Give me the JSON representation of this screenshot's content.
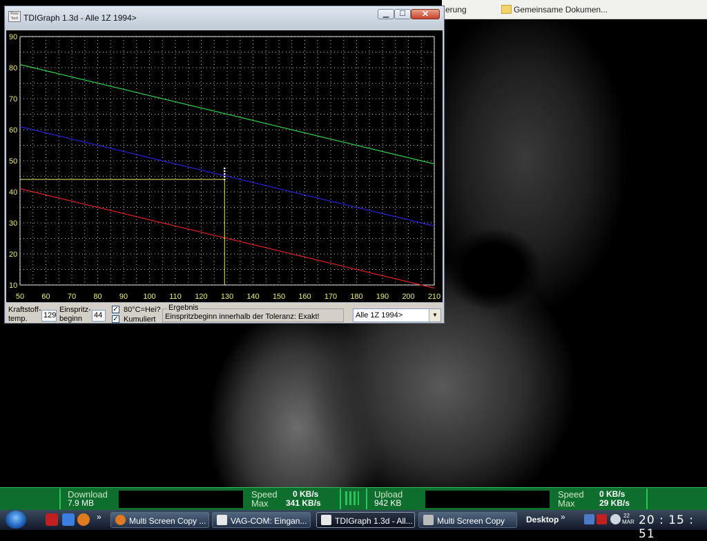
{
  "explorer_strip": {
    "item1": "erung",
    "item2": "Gemeinsame Dokumen..."
  },
  "window": {
    "title": "TDIGraph 1.3d - Alle 1Z 1994>",
    "logo_text": "Ross Tech",
    "buttons": {
      "minimize": "▁",
      "maximize": "☐",
      "close": "✕"
    }
  },
  "chart_data": {
    "type": "line",
    "title": "",
    "xlabel": "",
    "ylabel": "",
    "xlim": [
      50,
      210
    ],
    "ylim": [
      10,
      90
    ],
    "x_ticks": [
      50,
      60,
      70,
      80,
      90,
      100,
      110,
      120,
      130,
      140,
      150,
      160,
      170,
      180,
      190,
      200,
      210
    ],
    "y_ticks": [
      10,
      20,
      30,
      40,
      50,
      60,
      70,
      80,
      90
    ],
    "grid": true,
    "series": [
      {
        "color": "#2fd24a",
        "x": [
          50,
          210
        ],
        "y": [
          81,
          49
        ]
      },
      {
        "color": "#2424d8",
        "x": [
          50,
          210
        ],
        "y": [
          61,
          29
        ]
      },
      {
        "color": "#e02020",
        "x": [
          50,
          210
        ],
        "y": [
          41,
          9
        ]
      }
    ],
    "cursor": {
      "x": 129,
      "y": 44,
      "color": "#f0f070"
    }
  },
  "controls": {
    "fuel_temp_label_1": "Kraftstoff-",
    "fuel_temp_label_2": "temp.",
    "fuel_temp_value": "129",
    "injection_label_1": "Einspritz-",
    "injection_label_2": "beginn",
    "injection_value": "44",
    "checkbox_hot_label": "80°C=Hei?",
    "checkbox_hot_checked": "✓",
    "checkbox_cumulative_label": "Kumuliert",
    "checkbox_cumulative_checked": "✓",
    "result_title": "Ergebnis",
    "result_text": "Einspritzbeginn innerhalb der Toleranz: Exakt!",
    "engine_select": "Alle 1Z 1994>",
    "engine_select_arrow": "▼"
  },
  "network_monitor": {
    "download_label": "Download",
    "download_value": "7.9 MB",
    "download_speed_label": "Speed",
    "download_speed_value": "0 KB/s",
    "download_max_label": "Max",
    "download_max_value": "341 KB/s",
    "upload_label": "Upload",
    "upload_value": "942 KB",
    "upload_speed_label": "Speed",
    "upload_speed_value": "0 KB/s",
    "upload_max_label": "Max",
    "upload_max_value": "29 KB/s"
  },
  "taskbar": {
    "overflow_1": "»",
    "tasks": [
      {
        "label": "Multi Screen Copy ...",
        "icon": "firefox-icon"
      },
      {
        "label": "VAG-COM: Eingan...",
        "icon": "vag-icon"
      },
      {
        "label": "TDIGraph 1.3d - All...",
        "icon": "rosstech-icon"
      },
      {
        "label": "Multi Screen Copy",
        "icon": "camera-icon"
      }
    ],
    "desktop_label": "Desktop",
    "overflow_2": "»",
    "date_day": "22",
    "date_month": "MAR",
    "clock": "20 : 15 : 51"
  }
}
